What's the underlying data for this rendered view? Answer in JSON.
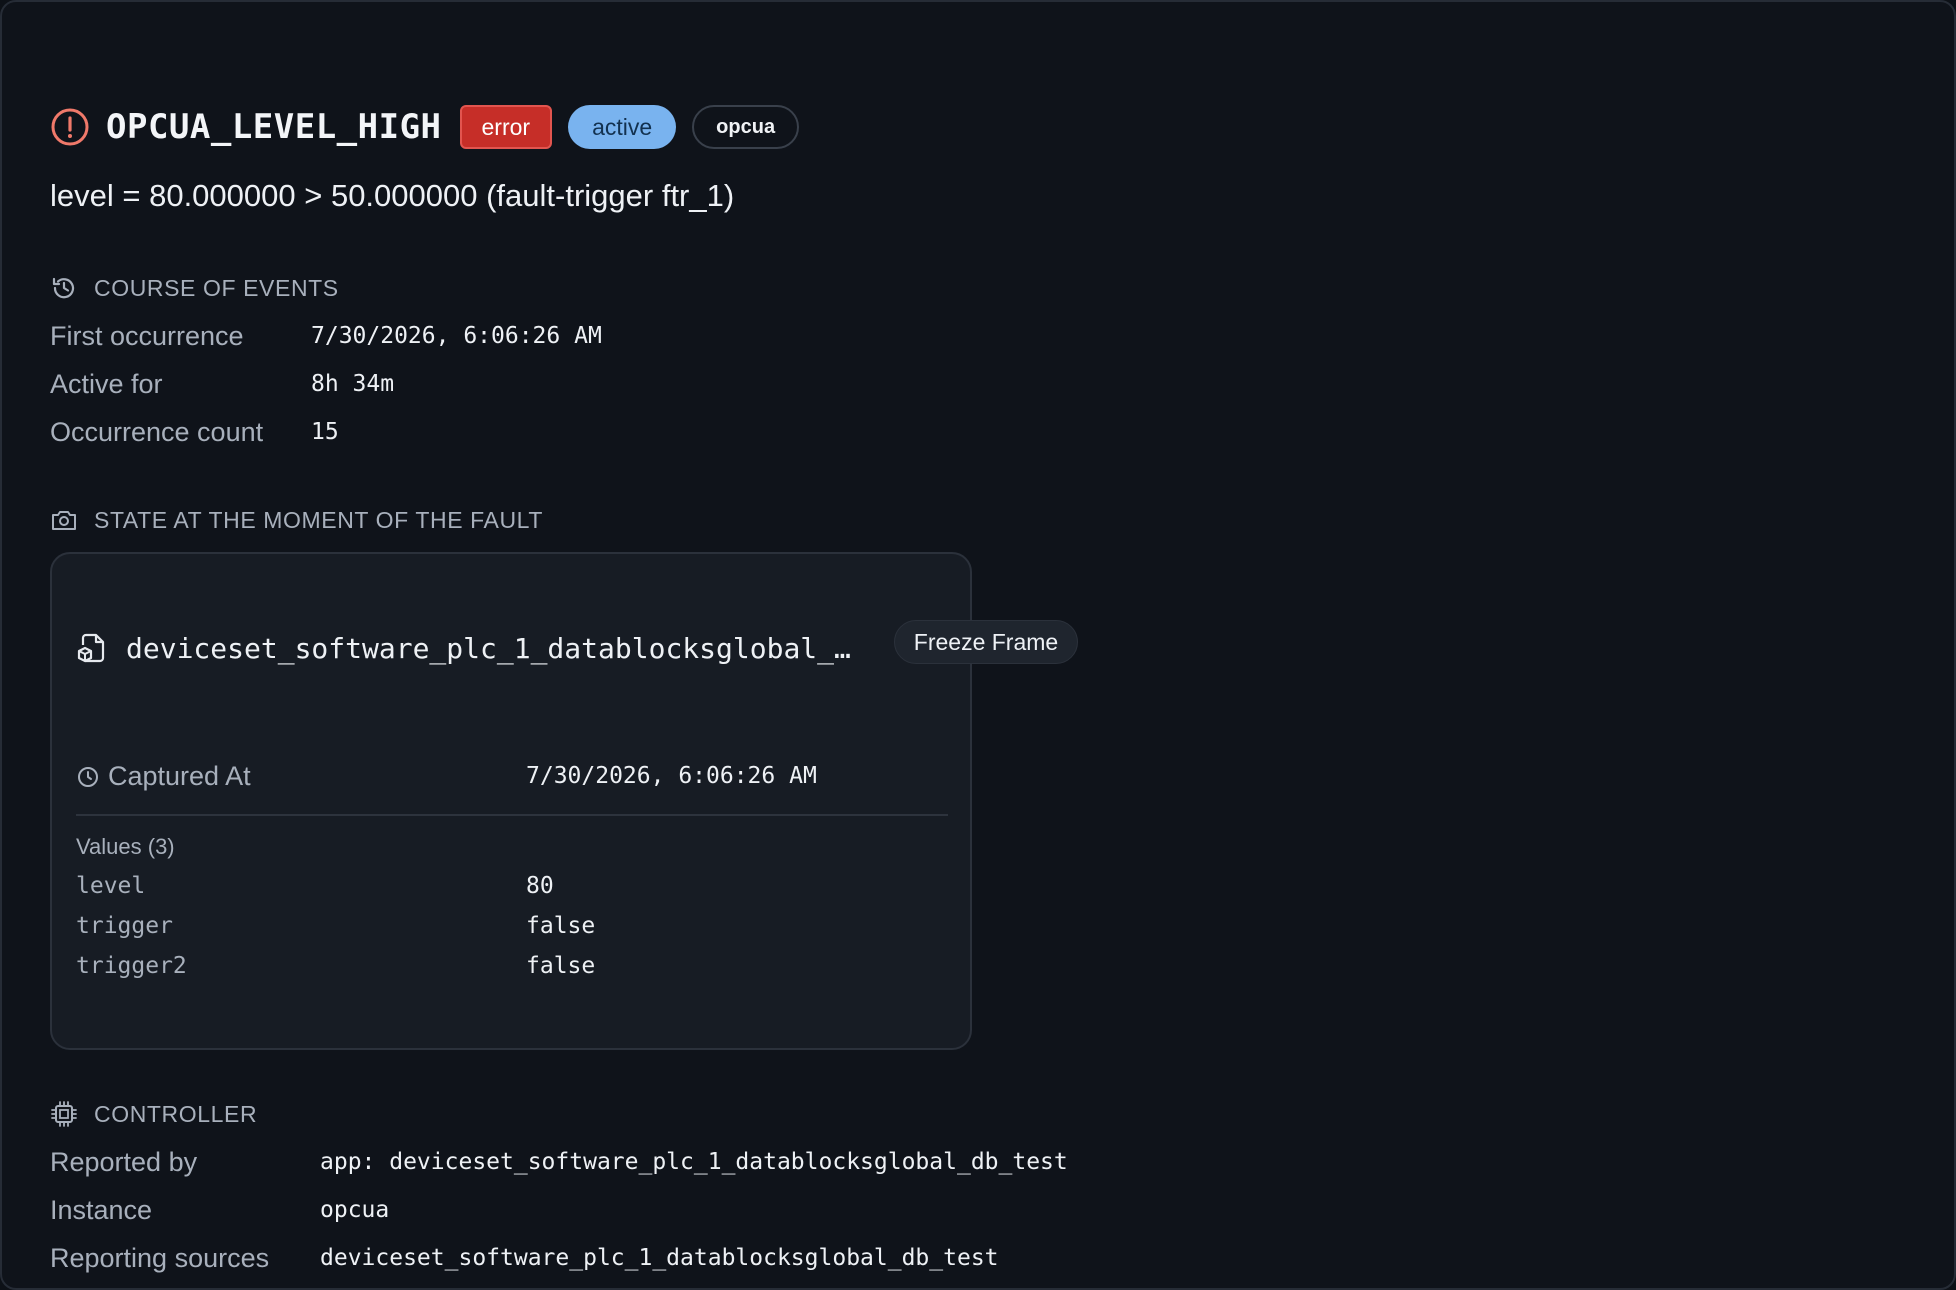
{
  "alert": {
    "title": "OPCUA_LEVEL_HIGH",
    "severity": "error",
    "status": "active",
    "source": "opcua",
    "message": "level = 80.000000 > 50.000000 (fault-trigger ftr_1)"
  },
  "course": {
    "heading": "COURSE OF EVENTS",
    "first_label": "First occurrence",
    "first_value": "7/30/2026, 6:06:26 AM",
    "active_label": "Active for",
    "active_value": "8h 34m",
    "count_label": "Occurrence count",
    "count_value": "15"
  },
  "snapshot": {
    "heading": "STATE AT THE MOMENT OF THE FAULT",
    "name": "deviceset_software_plc_1_datablocksglobal_d…",
    "kind": "Freeze Frame",
    "captured_label": "Captured At",
    "captured_value": "7/30/2026, 6:06:26 AM",
    "values_label": "Values (3)",
    "values": [
      {
        "key": "level",
        "value": "80"
      },
      {
        "key": "trigger",
        "value": "false"
      },
      {
        "key": "trigger2",
        "value": "false"
      }
    ]
  },
  "controller": {
    "heading": "CONTROLLER",
    "reported_label": "Reported by",
    "reported_value": "app: deviceset_software_plc_1_datablocksglobal_db_test",
    "instance_label": "Instance",
    "instance_value": "opcua",
    "sources_label": "Reporting sources",
    "sources_value": "deviceset_software_plc_1_datablocksglobal_db_test"
  },
  "colors": {
    "error": "#c62e28",
    "active": "#79b3ef",
    "alert_icon": "#f0796a",
    "background": "#0f131a",
    "card": "#171c24"
  }
}
